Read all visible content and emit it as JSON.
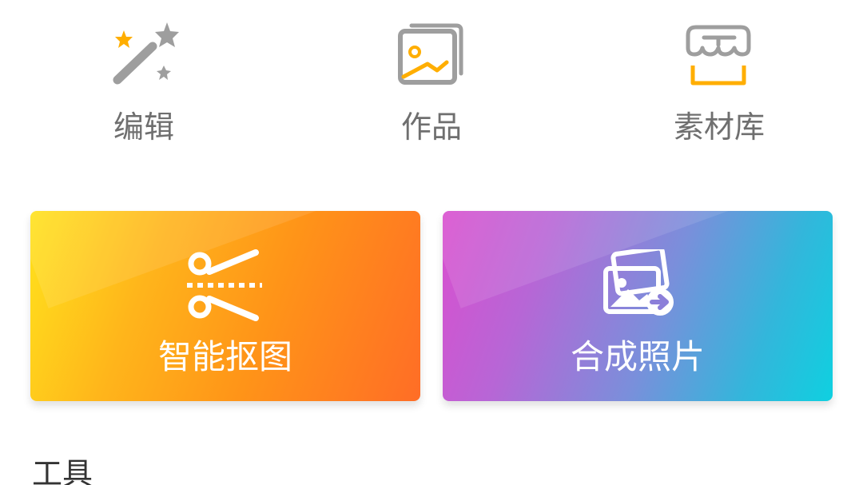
{
  "nav": {
    "edit_label": "编辑",
    "works_label": "作品",
    "library_label": "素材库"
  },
  "cards": {
    "cutout_label": "智能抠图",
    "compose_label": "合成照片"
  },
  "section": {
    "tools_title": "工具"
  },
  "colors": {
    "icon_gray": "#9e9e9e",
    "accent_orange": "#ffae00"
  }
}
